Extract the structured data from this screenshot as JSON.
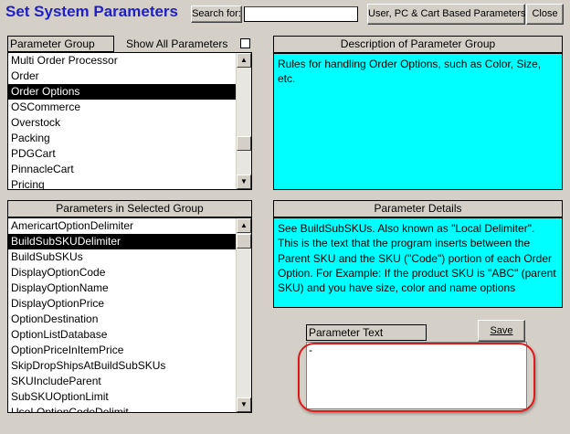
{
  "window": {
    "title": "Set System Parameters"
  },
  "toolbar": {
    "search_label": "Search for:",
    "search_value": "",
    "user_based_button": "User, PC & Cart Based Parameters",
    "close_button": "Close"
  },
  "groups": {
    "header": "Parameter Group",
    "show_all_label": "Show All Parameters",
    "show_all_checked": false,
    "items": [
      {
        "label": "Multi Order Processor",
        "selected": false
      },
      {
        "label": "Order",
        "selected": false
      },
      {
        "label": "Order Options",
        "selected": true
      },
      {
        "label": "OSCommerce",
        "selected": false
      },
      {
        "label": "Overstock",
        "selected": false
      },
      {
        "label": "Packing",
        "selected": false
      },
      {
        "label": "PDGCart",
        "selected": false
      },
      {
        "label": "PinnacleCart",
        "selected": false
      },
      {
        "label": "Pricing",
        "selected": false
      }
    ]
  },
  "group_description": {
    "header": "Description of Parameter Group",
    "text": "Rules for handling Order Options, such as Color, Size, etc."
  },
  "parameters": {
    "header": "Parameters in Selected Group",
    "items": [
      {
        "label": "AmericartOptionDelimiter",
        "selected": false
      },
      {
        "label": "BuildSubSKUDelimiter",
        "selected": true
      },
      {
        "label": "BuildSubSKUs",
        "selected": false
      },
      {
        "label": "DisplayOptionCode",
        "selected": false
      },
      {
        "label": "DisplayOptionName",
        "selected": false
      },
      {
        "label": "DisplayOptionPrice",
        "selected": false
      },
      {
        "label": "OptionDestination",
        "selected": false
      },
      {
        "label": "OptionListDatabase",
        "selected": false
      },
      {
        "label": "OptionPriceInItemPrice",
        "selected": false
      },
      {
        "label": "SkipDropShipsAtBuildSubSKUs",
        "selected": false
      },
      {
        "label": "SKUIncludeParent",
        "selected": false
      },
      {
        "label": "SubSKUOptionLimit",
        "selected": false
      },
      {
        "label": "UseLOptionCodeDelimit",
        "selected": false
      }
    ]
  },
  "parameter_details": {
    "header": "Parameter Details",
    "text": "See BuildSubSKUs. Also known as \"Local Delimiter\". This is the text that the program inserts between the Parent SKU and the SKU (\"Code\") portion of each Order Option. For Example: If the product SKU is \"ABC\" (parent SKU) and you have size, color and name options"
  },
  "parameter_text": {
    "label": "Parameter Text",
    "value": "-",
    "save_button": "Save"
  },
  "colors": {
    "title_blue": "#1f1fc8",
    "description_cyan": "#00ffff",
    "highlight_red": "#e01818",
    "window_gray": "#d4d0c8"
  }
}
